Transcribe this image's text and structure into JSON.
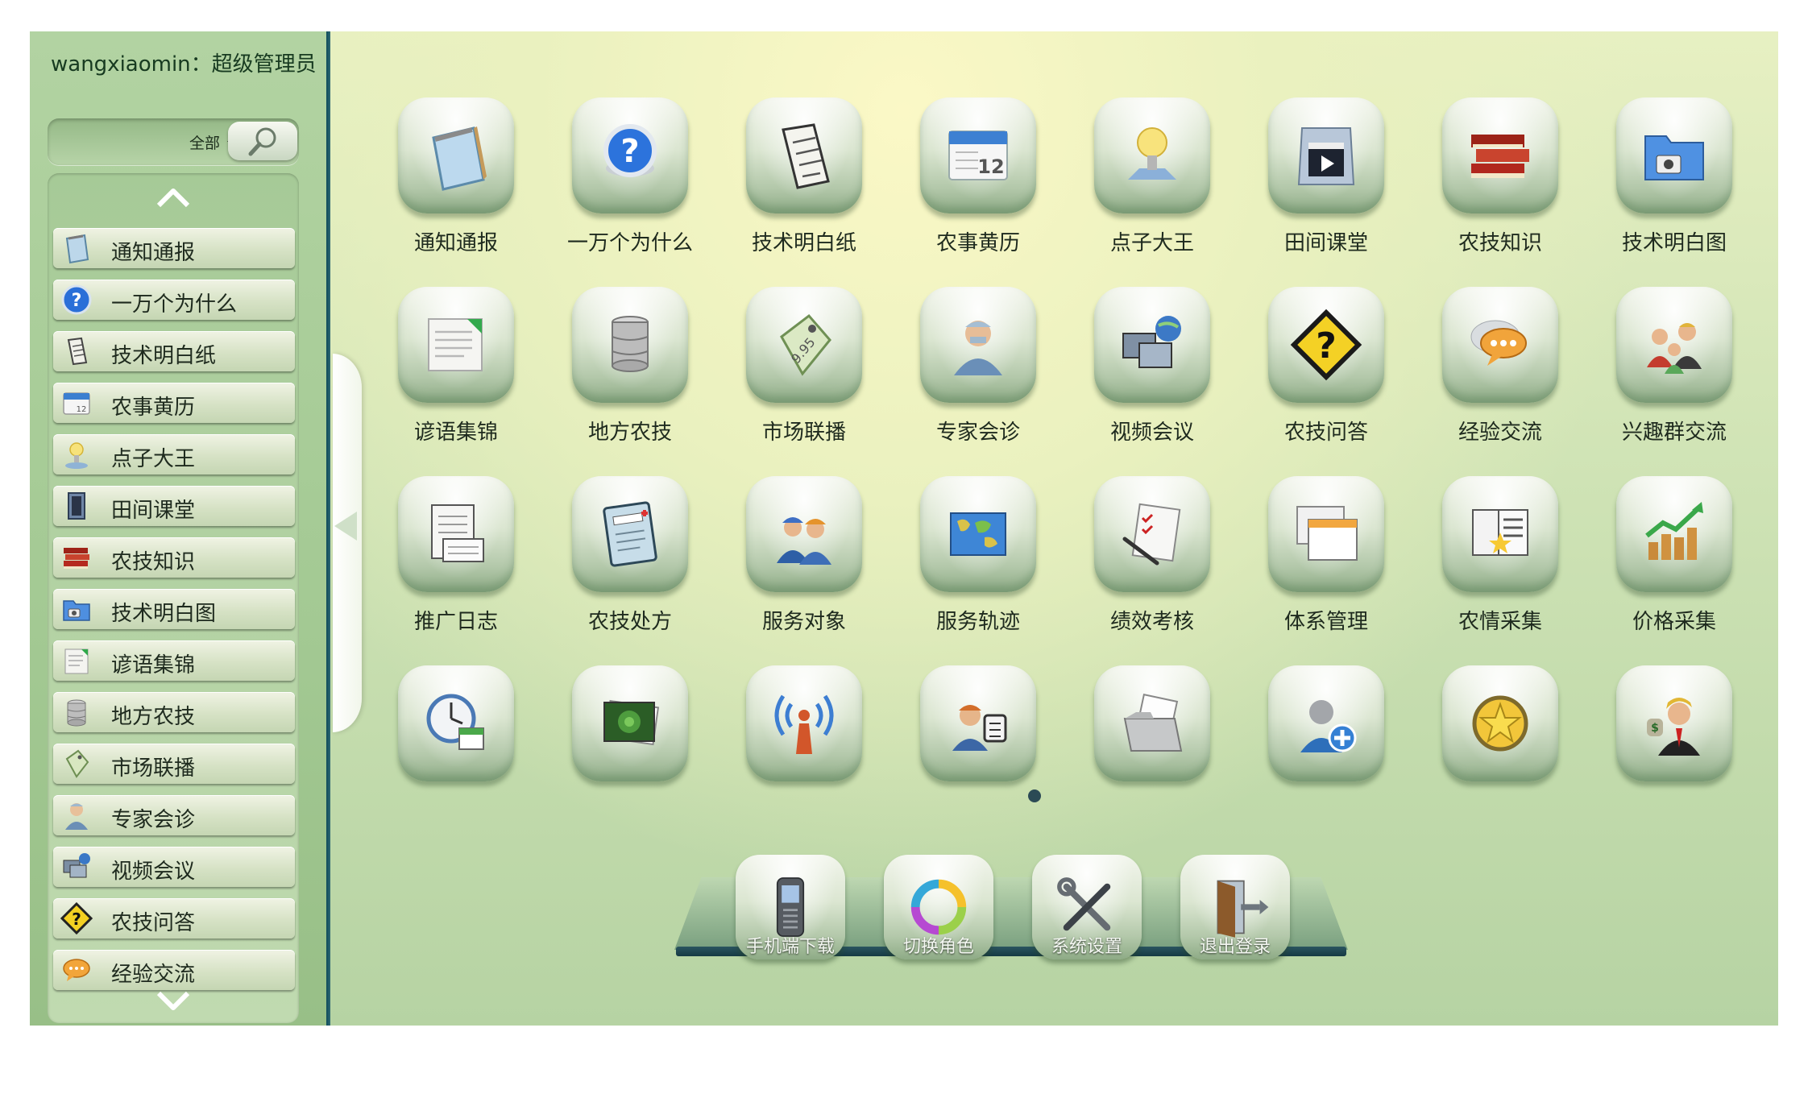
{
  "sidebar": {
    "user_label": "wangxiaomin：超级管理员",
    "search": {
      "scope": "全部"
    },
    "items": [
      {
        "label": "通知通报",
        "icon": "notepad-icon"
      },
      {
        "label": "一万个为什么",
        "icon": "question-icon"
      },
      {
        "label": "技术明白纸",
        "icon": "scroll-icon"
      },
      {
        "label": "农事黄历",
        "icon": "calendar-icon"
      },
      {
        "label": "点子大王",
        "icon": "lightbulb-icon"
      },
      {
        "label": "田间课堂",
        "icon": "film-icon"
      },
      {
        "label": "农技知识",
        "icon": "books-icon"
      },
      {
        "label": "技术明白图",
        "icon": "photo-folder-icon"
      },
      {
        "label": "谚语集锦",
        "icon": "document-icon"
      },
      {
        "label": "地方农技",
        "icon": "database-icon"
      },
      {
        "label": "市场联播",
        "icon": "price-tag-icon"
      },
      {
        "label": "专家会诊",
        "icon": "doctor-icon"
      },
      {
        "label": "视频会议",
        "icon": "network-icon"
      },
      {
        "label": "农技问答",
        "icon": "question-sign-icon"
      },
      {
        "label": "经验交流",
        "icon": "chat-bubble-icon"
      }
    ]
  },
  "apps": [
    {
      "label": "通知通报",
      "icon": "notepad-icon"
    },
    {
      "label": "一万个为什么",
      "icon": "question-icon"
    },
    {
      "label": "技术明白纸",
      "icon": "scroll-icon"
    },
    {
      "label": "农事黄历",
      "icon": "calendar-icon"
    },
    {
      "label": "点子大王",
      "icon": "lightbulb-icon"
    },
    {
      "label": "田间课堂",
      "icon": "film-icon"
    },
    {
      "label": "农技知识",
      "icon": "books-icon"
    },
    {
      "label": "技术明白图",
      "icon": "photo-folder-icon"
    },
    {
      "label": "谚语集锦",
      "icon": "document-icon"
    },
    {
      "label": "地方农技",
      "icon": "database-icon"
    },
    {
      "label": "市场联播",
      "icon": "price-tag-icon"
    },
    {
      "label": "专家会诊",
      "icon": "doctor-icon"
    },
    {
      "label": "视频会议",
      "icon": "network-icon"
    },
    {
      "label": "农技问答",
      "icon": "question-sign-icon"
    },
    {
      "label": "经验交流",
      "icon": "chat-bubble-icon"
    },
    {
      "label": "兴趣群交流",
      "icon": "people-group-icon"
    },
    {
      "label": "推广日志",
      "icon": "log-book-icon"
    },
    {
      "label": "农技处方",
      "icon": "prescription-icon"
    },
    {
      "label": "服务对象",
      "icon": "workers-icon"
    },
    {
      "label": "服务轨迹",
      "icon": "world-map-icon"
    },
    {
      "label": "绩效考核",
      "icon": "checklist-icon"
    },
    {
      "label": "体系管理",
      "icon": "windows-icon"
    },
    {
      "label": "农情采集",
      "icon": "collection-icon"
    },
    {
      "label": "价格采集",
      "icon": "chart-growth-icon"
    },
    {
      "label": "",
      "icon": "clock-calendar-icon"
    },
    {
      "label": "",
      "icon": "photo-album-icon"
    },
    {
      "label": "",
      "icon": "antenna-icon"
    },
    {
      "label": "",
      "icon": "user-card-icon"
    },
    {
      "label": "",
      "icon": "folder-files-icon"
    },
    {
      "label": "",
      "icon": "add-user-icon"
    },
    {
      "label": "",
      "icon": "star-badge-icon"
    },
    {
      "label": "",
      "icon": "businessman-icon"
    }
  ],
  "dock": [
    {
      "label": "手机端下载",
      "icon": "mobile-phone-icon"
    },
    {
      "label": "切换角色",
      "icon": "refresh-cycle-icon"
    },
    {
      "label": "系统设置",
      "icon": "tools-icon"
    },
    {
      "label": "退出登录",
      "icon": "exit-door-icon"
    }
  ],
  "colors": {
    "accent_divider": "#1d5665",
    "page_dot": "#2b4a55",
    "tile_top": "#f2f5ec",
    "tile_bottom": "#8eab86"
  }
}
